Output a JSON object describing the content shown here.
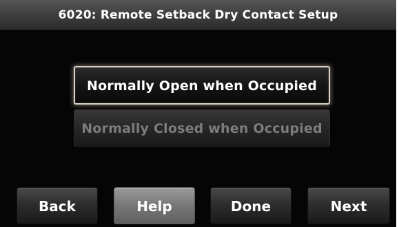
{
  "header": {
    "title": "6020: Remote Setback Dry Contact Setup"
  },
  "options": [
    {
      "label": "Normally Open when Occupied",
      "selected": true
    },
    {
      "label": "Normally Closed when Occupied",
      "selected": false
    }
  ],
  "footer": {
    "back_label": "Back",
    "help_label": "Help",
    "done_label": "Done",
    "next_label": "Next"
  },
  "colors": {
    "screen_background": "#050505",
    "title_bar": "#404040",
    "selected_border": "#d9d2c4",
    "disabled_text": "#7d7d7d",
    "help_button": "#7a7a7a"
  }
}
